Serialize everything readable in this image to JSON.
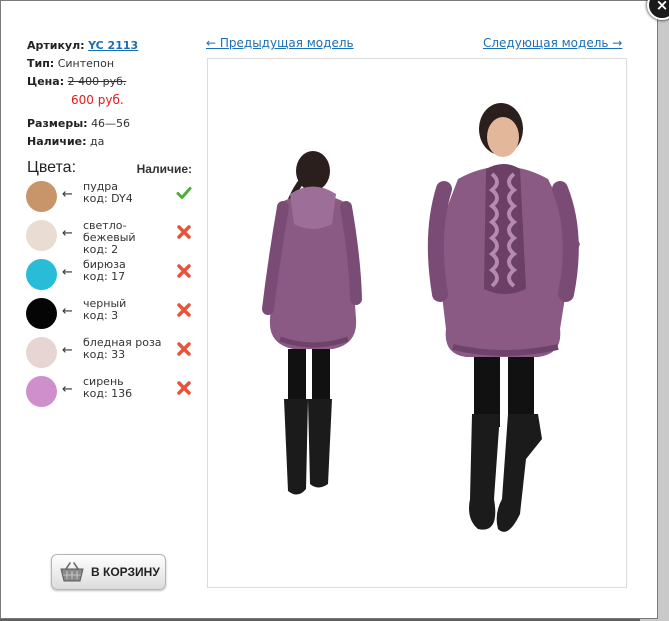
{
  "product": {
    "article_label": "Артикул:",
    "article_value": "YC 2113",
    "type_label": "Тип:",
    "type_value": "Синтепон",
    "price_label": "Цена:",
    "old_price": "2 400 руб.",
    "new_price": "600 руб.",
    "sizes_label": "Размеры:",
    "sizes_value": "46—56",
    "stock_label": "Наличие:",
    "stock_value": "да"
  },
  "colors_section": {
    "title": "Цвета:",
    "availability_title": "Наличие:",
    "items": [
      {
        "name": "пудра",
        "code": "код: DY4",
        "color": "#c8956b",
        "available": true
      },
      {
        "name": "светло-бежевый",
        "name_line1": "светло-",
        "name_line2": "бежевый",
        "code": "код: 2",
        "color": "#e9ddd2",
        "available": false
      },
      {
        "name": "бирюза",
        "code": "код: 17",
        "color": "#29bcd8",
        "available": false
      },
      {
        "name": "черный",
        "code": "код: 3",
        "color": "#050505",
        "available": false
      },
      {
        "name": "бледная роза",
        "code": "код: 33",
        "color": "#e7d5d3",
        "available": false
      },
      {
        "name": "сирень",
        "code": "код: 136",
        "color": "#cf8fcc",
        "available": false
      }
    ],
    "arrow_glyph": "←"
  },
  "cart_button": {
    "label": "В КОРЗИНУ",
    "icon": "basket-icon"
  },
  "navigation": {
    "prev_label": "← Предыдущая модель",
    "next_label": "Следующая модель →"
  },
  "close_button": {
    "label": "×"
  },
  "colors": {
    "link": "#1a6fb7",
    "sale_price": "#e21b1b",
    "check": "#4caf3a",
    "cross": "#e8533a",
    "jacket": "#8a5a84"
  }
}
